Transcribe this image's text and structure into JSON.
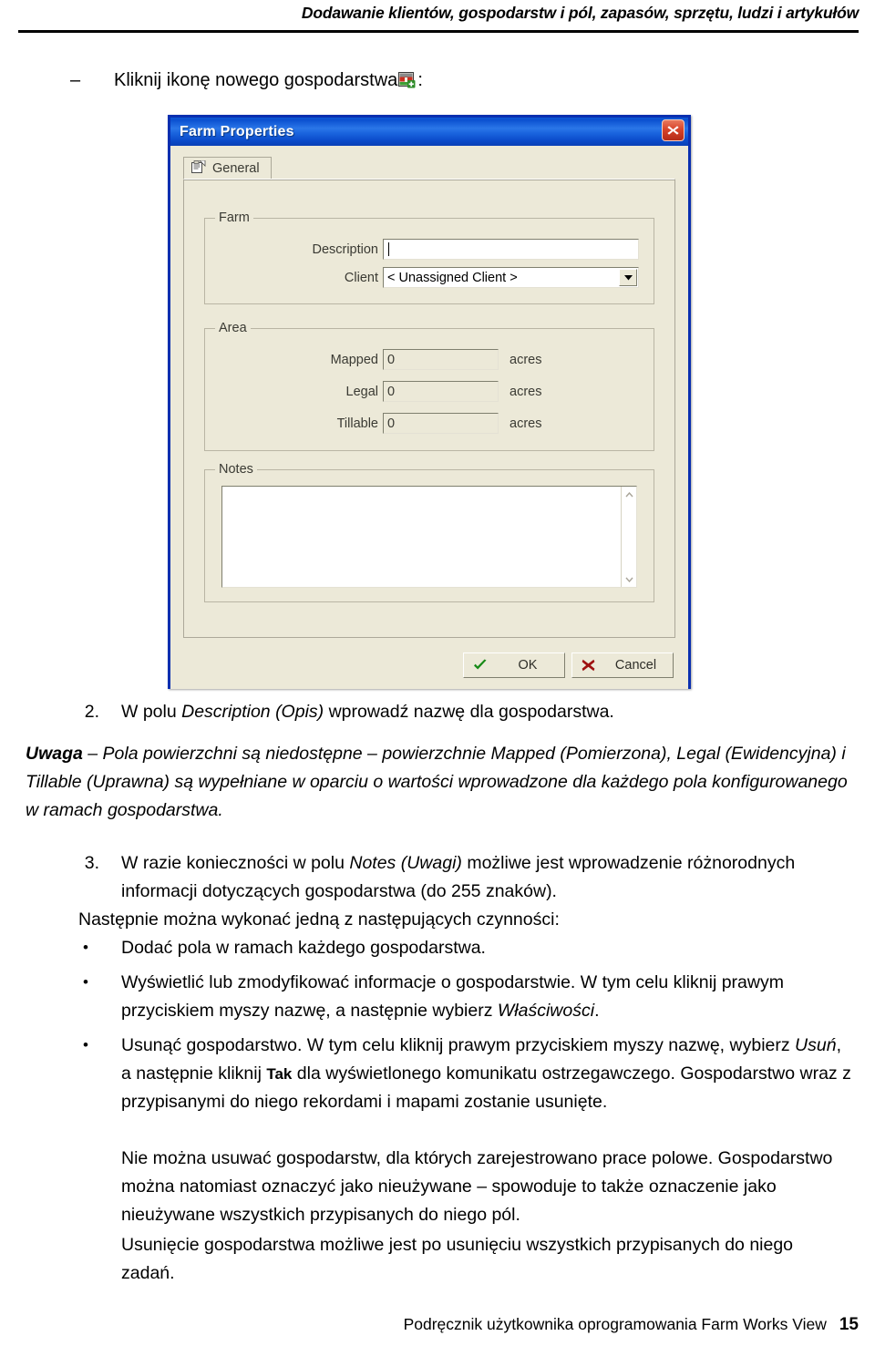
{
  "page_header": {
    "text": "Dodawanie klientów, gospodarstw i pól, zapasów, sprzętu, ludzi i artykułów"
  },
  "intro": {
    "dash": "–",
    "text_before_icon": "Kliknij ikonę nowego gospodarstwa",
    "icon_name": "new-farm-icon",
    "text_after_icon": ":"
  },
  "dialog": {
    "title": "Farm Properties",
    "close_label": "✕",
    "tab": {
      "label": "General",
      "icon_name": "properties-page-icon"
    },
    "farm_group": {
      "title": "Farm",
      "description_label": "Description",
      "description_value": "",
      "client_label": "Client",
      "client_value": "< Unassigned Client >"
    },
    "area_group": {
      "title": "Area",
      "unit": "acres",
      "rows": [
        {
          "label": "Mapped",
          "value": "0"
        },
        {
          "label": "Legal",
          "value": "0"
        },
        {
          "label": "Tillable",
          "value": "0"
        }
      ]
    },
    "notes_group": {
      "title": "Notes",
      "value": ""
    },
    "buttons": {
      "ok": "OK",
      "cancel": "Cancel"
    },
    "colors": {
      "titlebar_blue": "#0a4fd0",
      "dialog_face": "#ece9d8",
      "close_red": "#d8442a",
      "ok_check_green": "#178a17",
      "cancel_x_red": "#9e1010"
    }
  },
  "body": {
    "step2_num": "2.",
    "step2_pre": "W polu ",
    "step2_ital": "Description (Opis)",
    "step2_post": " wprowadź nazwę dla gospodarstwa.",
    "note_label": "Uwaga",
    "note_text": " – Pola powierzchni są niedostępne – powierzchnie Mapped (Pomierzona), Legal (Ewidencyjna) i Tillable (Uprawna) są wypełniane w oparciu o wartości wprowadzone dla każdego pola konfigurowanego w ramach gospodarstwa.",
    "step3_num": "3.",
    "step3_pre": "W razie konieczności w polu ",
    "step3_ital": "Notes (Uwagi)",
    "step3_post": " możliwe jest wprowadzenie różnorodnych informacji dotyczących gospodarstwa (do 255 znaków).",
    "lead_in": "Następnie można wykonać jedną z następujących czynności:",
    "bullet1": "Dodać pola w ramach każdego gospodarstwa.",
    "bullet2_pre": "Wyświetlić lub zmodyfikować informacje o gospodarstwie. W tym celu kliknij prawym przyciskiem myszy nazwę, a następnie wybierz ",
    "bullet2_ital": "Właściwości",
    "bullet2_post": ".",
    "bullet3_pre": "Usunąć gospodarstwo. W tym celu kliknij prawym przyciskiem myszy nazwę, wybierz ",
    "bullet3_ital": "Usuń",
    "bullet3_mid": ", a następnie kliknij ",
    "bullet3_tak": "Tak",
    "bullet3_post": " dla wyświetlonego komunikatu ostrzegawczego. Gospodarstwo wraz z przypisanymi do niego rekordami i mapami zostanie usunięte.",
    "para1": "Nie można usuwać gospodarstw, dla których zarejestrowano prace polowe. Gospodarstwo można natomiast oznaczyć jako nieużywane – spowoduje to także oznaczenie jako nieużywane wszystkich przypisanych do niego pól.",
    "para2": "Usunięcie gospodarstwa możliwe jest po usunięciu wszystkich przypisanych do niego zadań."
  },
  "footer": {
    "text": "Podręcznik użytkownika oprogramowania Farm Works View",
    "page_number": "15"
  }
}
